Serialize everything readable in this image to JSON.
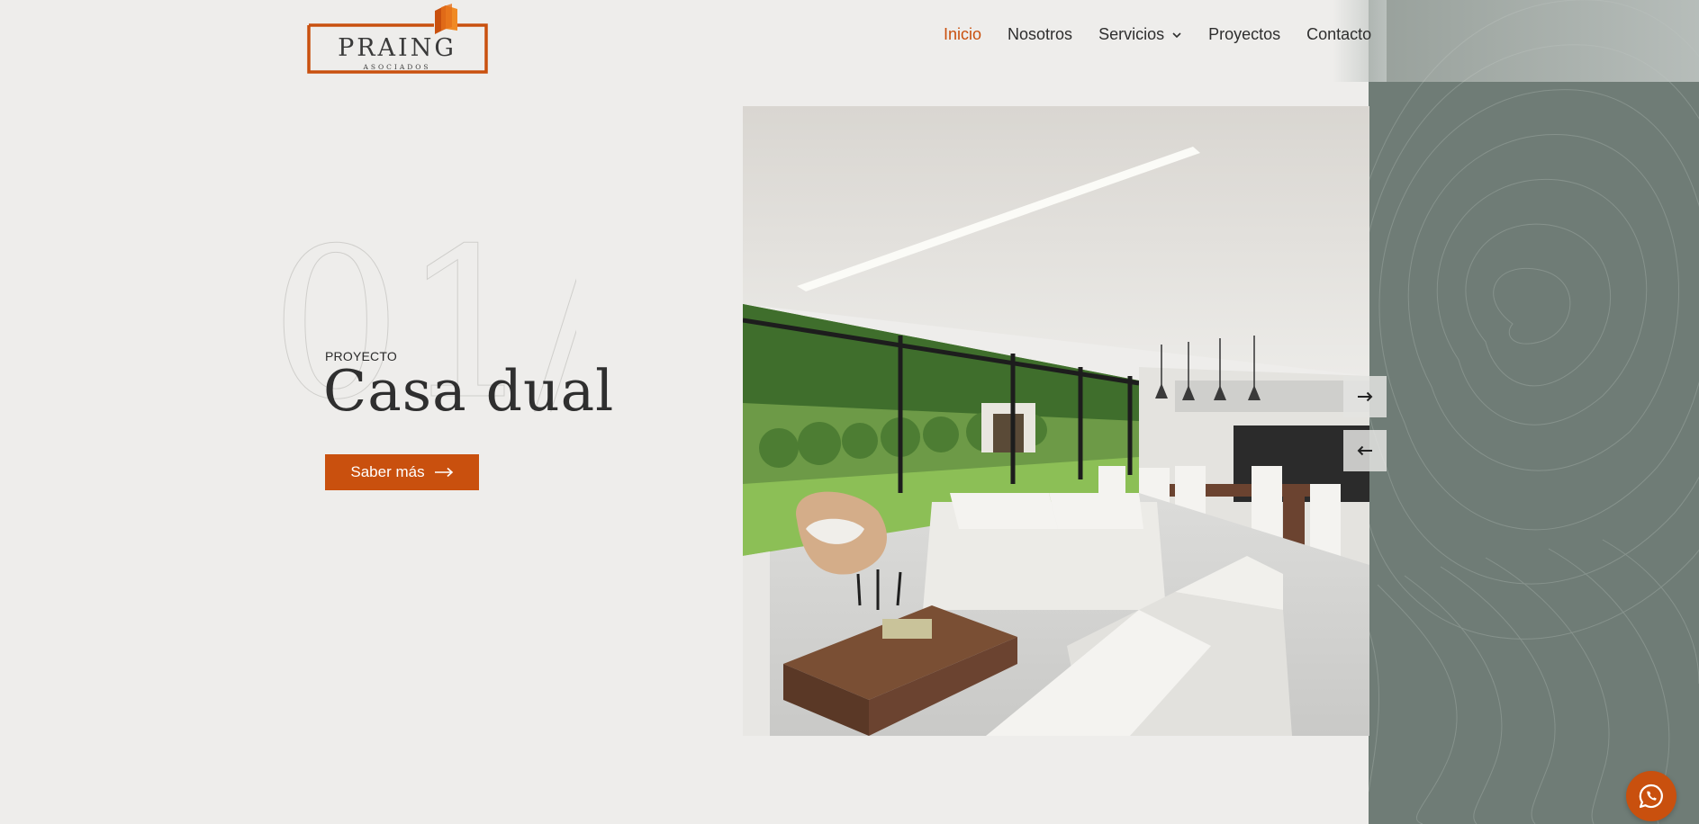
{
  "brand": {
    "name": "PRAING",
    "tagline": "ASOCIADOS",
    "accent_color": "#c9500e",
    "logo_icon": "book-icon"
  },
  "nav": {
    "items": [
      {
        "label": "Inicio",
        "active": true
      },
      {
        "label": "Nosotros",
        "active": false
      },
      {
        "label": "Servicios",
        "active": false,
        "has_dropdown": true
      },
      {
        "label": "Proyectos",
        "active": false
      },
      {
        "label": "Contacto",
        "active": false
      }
    ]
  },
  "hero": {
    "slide_number": "01/",
    "eyebrow": "PROYECTO",
    "title": "Casa dual",
    "cta_label": "Saber más",
    "cta_icon": "arrow-right-icon",
    "image_subject": "interior-living-dining-room"
  },
  "slider": {
    "next_icon": "arrow-right-icon",
    "prev_icon": "arrow-left-icon"
  },
  "floating": {
    "whatsapp_icon": "whatsapp-icon"
  },
  "colors": {
    "background": "#eeedeb",
    "side_panel": "#6f7c76",
    "text": "#2f2f2f"
  }
}
